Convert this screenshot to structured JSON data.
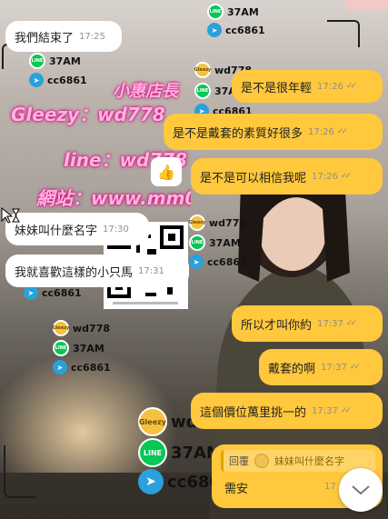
{
  "watermark": {
    "store": "小惠店長",
    "gleezy": "Gleezy：wd778",
    "line": "line：wd778",
    "site": "網站：www.mm0208"
  },
  "badge": {
    "gleezy_id": "wd778",
    "line_id": "37AM",
    "telegram_id": "cc6861",
    "gleezy_icon_text": "Gleezy",
    "line_icon_text": "LINE",
    "big_gleezy_id": "wd",
    "big_line_id": "37AM",
    "big_telegram_id": "cc686"
  },
  "messages": [
    {
      "text": "我們結束了",
      "time": "17:25",
      "side": "in"
    },
    {
      "text": "是不是很年輕",
      "time": "17:26",
      "side": "out"
    },
    {
      "text": "是不是戴套的素質好很多",
      "time": "17:26",
      "side": "out"
    },
    {
      "text": "是不是可以相信我呢",
      "time": "17:26",
      "side": "out"
    },
    {
      "text": "妹妹叫什麼名字",
      "time": "17:30",
      "side": "in"
    },
    {
      "text": "我就喜歡這樣的小只馬",
      "time": "17:31",
      "side": "in"
    },
    {
      "text": "所以才叫你約",
      "time": "17:37",
      "side": "out"
    },
    {
      "text": "戴套的啊",
      "time": "17:37",
      "side": "out"
    },
    {
      "text": "這個價位萬里挑一的",
      "time": "17:37",
      "side": "out"
    }
  ],
  "reaction": {
    "icon": "thumbs-up"
  },
  "reply_message": {
    "quote_label": "回覆",
    "quote_text": "妹妹叫什麼名字",
    "text": "需安",
    "time": "17"
  },
  "colors": {
    "outgoing": "#ffc83d",
    "incoming": "#ffffff",
    "watermark": "#ffb3df"
  }
}
